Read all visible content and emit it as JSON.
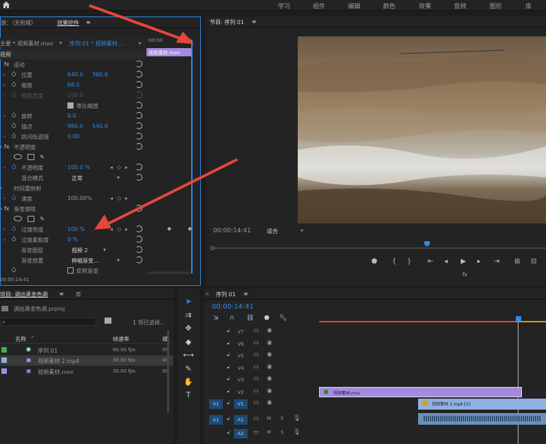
{
  "menu": {
    "items": [
      "学习",
      "组件",
      "编辑",
      "颜色",
      "效果",
      "音频",
      "图形",
      "库"
    ]
  },
  "source_panel": {
    "tab1": "源：（无剪辑）",
    "tab2": "效果控件",
    "clip_master": "主要 * 视频素材.mov",
    "clip_seq": "序列 01 * 视频素材...",
    "time_start": ":00:00",
    "time_end": "00:00",
    "clip_label": "视频素材.mov",
    "timecode": "00:00:14:41"
  },
  "effects": {
    "video_header": "视频",
    "motion": "运动",
    "position": {
      "label": "位置",
      "x": "640.0",
      "y": "360.0"
    },
    "scale": {
      "label": "缩放",
      "value": "68.0"
    },
    "scale_width": {
      "label": "缩放宽度",
      "value": "100.0"
    },
    "uniform_scale": "等比缩放",
    "rotation": {
      "label": "旋转",
      "value": "0.0"
    },
    "anchor": {
      "label": "锚点",
      "x": "960.0",
      "y": "540.0"
    },
    "anti_flicker": {
      "label": "防闪烁滤镜",
      "value": "0.00"
    },
    "opacity": "不透明度",
    "opacity_prop": {
      "label": "不透明度",
      "value": "100.0 %"
    },
    "blend_mode": {
      "label": "混合模式",
      "value": "正常"
    },
    "time_remap": "时间重映射",
    "speed": {
      "label": "速度",
      "value": "100.00%"
    },
    "gradient_wipe": "渐变擦除",
    "transition_completion": {
      "label": "过渡完成",
      "value": "100 %"
    },
    "transition_softness": {
      "label": "过渡柔和度",
      "value": "0 %"
    },
    "gradient_layer": {
      "label": "渐变图层",
      "value": "视频 2"
    },
    "gradient_placement": {
      "label": "渐变放置",
      "value": "伸缩渐变..."
    },
    "invert": "反转渐变"
  },
  "program": {
    "title": "节目: 序列 01",
    "timecode": "00:00:14:41",
    "fit": "适合"
  },
  "project": {
    "tab1": "项目: 调出黑金色调",
    "tab2": "库",
    "file": "调出黑金色调.prproj",
    "count": "1 项已选择...",
    "col_name": "名称",
    "col_rate": "帧速率",
    "col_extra": "媒",
    "items": [
      {
        "name": "序列 01",
        "rate": "60.00 fps",
        "extra": "00",
        "color": "#3fae49"
      },
      {
        "name": "视频素材 2.mp4",
        "rate": "30.00 fps",
        "extra": "00",
        "color": "#8fb0e0"
      },
      {
        "name": "视频素材.mov",
        "rate": "30.00 fps",
        "extra": "00",
        "color": "#a58be0"
      }
    ]
  },
  "timeline": {
    "title": "序列 01",
    "timecode": "00:00:14:41",
    "video_tracks": [
      "V7",
      "V6",
      "V5",
      "V4",
      "V3",
      "V2",
      "V1"
    ],
    "audio_tracks": [
      "A1",
      "A2"
    ],
    "clip_mov": "视频素材.mov",
    "clip_mp4": "视频素材 2.mp4 [V]",
    "m": "M",
    "s": "S"
  },
  "colors": {
    "accent": "#2d8ceb",
    "purple_clip": "#a58be0",
    "blue_clip": "#8fb0e0",
    "annotation": "#e8463d"
  }
}
